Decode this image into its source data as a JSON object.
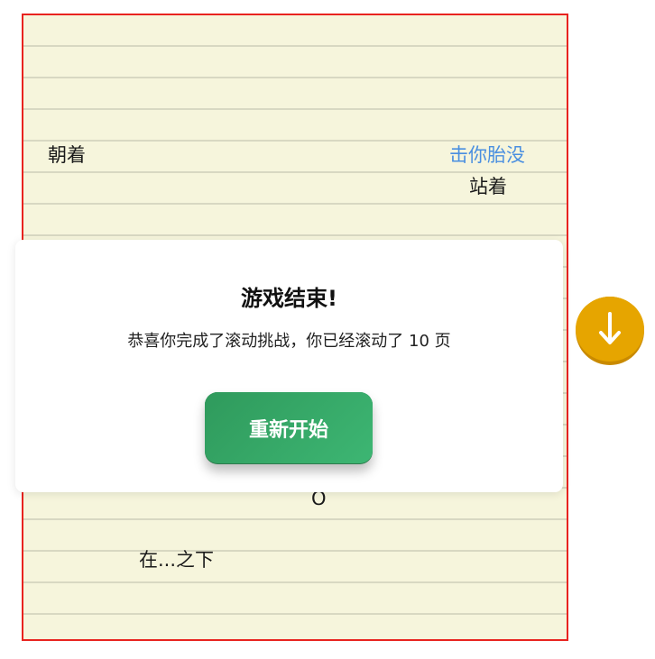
{
  "board": {
    "words": [
      {
        "text": "朝着",
        "highlighted": false
      },
      {
        "text": "击你胎没",
        "highlighted": true
      },
      {
        "text": "站着",
        "highlighted": false
      },
      {
        "text": "O",
        "highlighted": false
      },
      {
        "text": "在...之下",
        "highlighted": false
      }
    ],
    "colors": {
      "paper": "#f6f5dc",
      "border": "#e8231f",
      "highlight": "#4a8fe0"
    }
  },
  "modal": {
    "title": "游戏结束!",
    "message": "恭喜你完成了滚动挑战，你已经滚动了 10 页",
    "restart_label": "重新开始",
    "button_color": "#3db673"
  },
  "scroll_button": {
    "icon": "arrow-down-icon",
    "color": "#e6a500"
  }
}
